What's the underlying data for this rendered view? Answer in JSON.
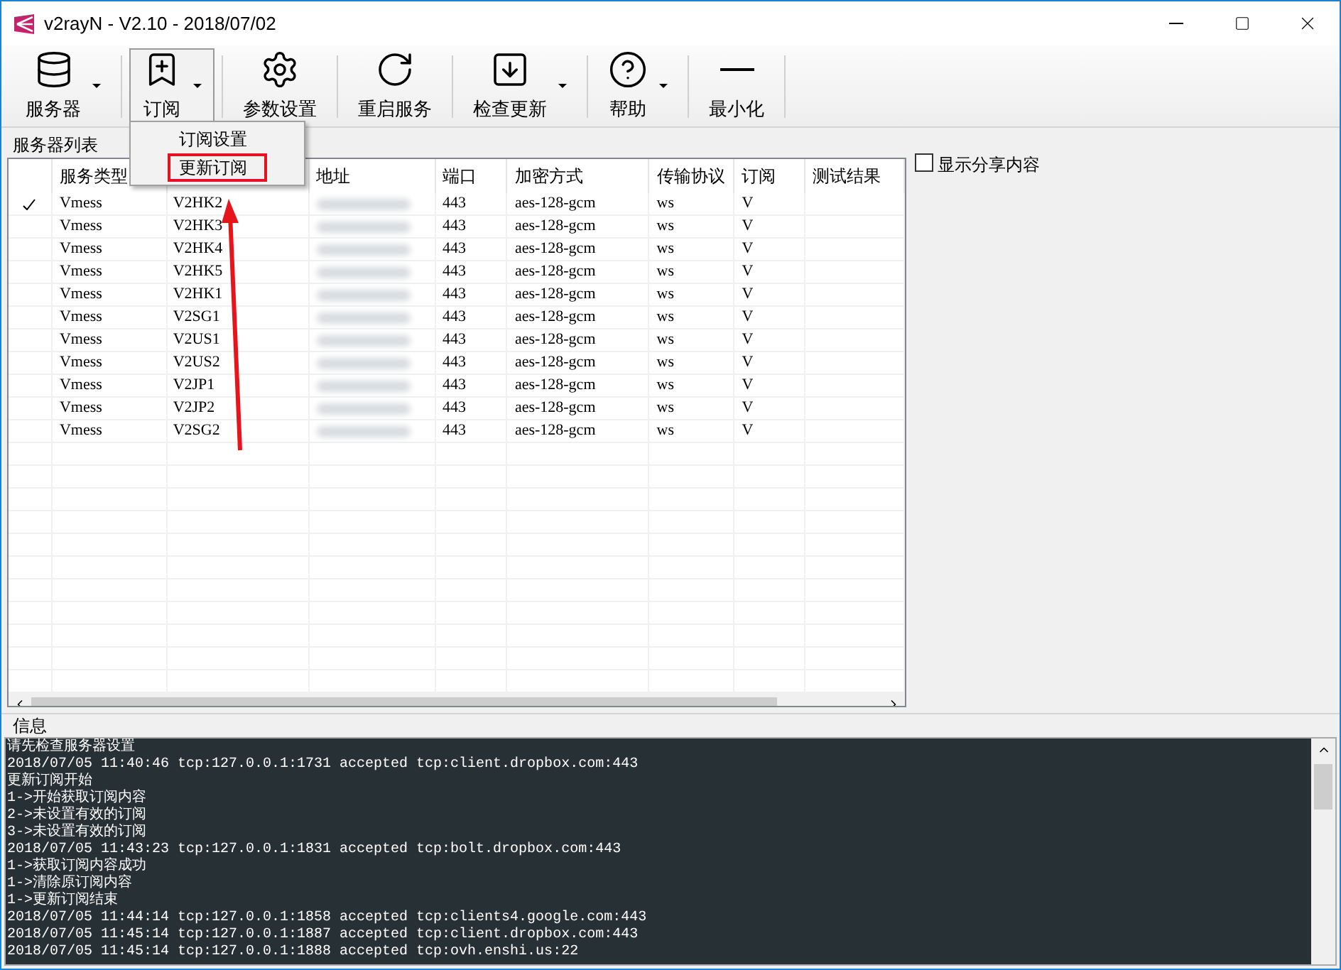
{
  "window": {
    "title": "v2rayN - V2.10 - 2018/07/02"
  },
  "toolbar": [
    {
      "label": "服务器",
      "kind": "database",
      "dropdown": true,
      "pressed": false
    },
    {
      "label": "订阅",
      "kind": "bookmark",
      "dropdown": true,
      "pressed": true
    },
    {
      "label": "参数设置",
      "kind": "gear",
      "dropdown": false,
      "pressed": false
    },
    {
      "label": "重启服务",
      "kind": "restart",
      "dropdown": false,
      "pressed": false
    },
    {
      "label": "检查更新",
      "kind": "download",
      "dropdown": true,
      "pressed": false
    },
    {
      "label": "帮助",
      "kind": "help",
      "dropdown": true,
      "pressed": false
    },
    {
      "label": "最小化",
      "kind": "minimize",
      "dropdown": false,
      "pressed": false
    }
  ],
  "menu": [
    {
      "label": "订阅设置",
      "highlighted": false
    },
    {
      "label": "更新订阅",
      "highlighted": true
    }
  ],
  "server_list": {
    "title": "服务器列表",
    "columns": [
      "服务类型",
      null,
      "地址",
      "端口",
      "加密方式",
      "传输协议",
      "订阅",
      "测试结果"
    ],
    "rows": [
      {
        "active": true,
        "type": "Vmess",
        "name": "V2HK2",
        "port": "443",
        "encryption": "aes-128-gcm",
        "transport": "ws",
        "subscription": "V"
      },
      {
        "active": false,
        "type": "Vmess",
        "name": "V2HK3",
        "port": "443",
        "encryption": "aes-128-gcm",
        "transport": "ws",
        "subscription": "V"
      },
      {
        "active": false,
        "type": "Vmess",
        "name": "V2HK4",
        "port": "443",
        "encryption": "aes-128-gcm",
        "transport": "ws",
        "subscription": "V"
      },
      {
        "active": false,
        "type": "Vmess",
        "name": "V2HK5",
        "port": "443",
        "encryption": "aes-128-gcm",
        "transport": "ws",
        "subscription": "V"
      },
      {
        "active": false,
        "type": "Vmess",
        "name": "V2HK1",
        "port": "443",
        "encryption": "aes-128-gcm",
        "transport": "ws",
        "subscription": "V"
      },
      {
        "active": false,
        "type": "Vmess",
        "name": "V2SG1",
        "port": "443",
        "encryption": "aes-128-gcm",
        "transport": "ws",
        "subscription": "V"
      },
      {
        "active": false,
        "type": "Vmess",
        "name": "V2US1",
        "port": "443",
        "encryption": "aes-128-gcm",
        "transport": "ws",
        "subscription": "V"
      },
      {
        "active": false,
        "type": "Vmess",
        "name": "V2US2",
        "port": "443",
        "encryption": "aes-128-gcm",
        "transport": "ws",
        "subscription": "V"
      },
      {
        "active": false,
        "type": "Vmess",
        "name": "V2JP1",
        "port": "443",
        "encryption": "aes-128-gcm",
        "transport": "ws",
        "subscription": "V"
      },
      {
        "active": false,
        "type": "Vmess",
        "name": "V2JP2",
        "port": "443",
        "encryption": "aes-128-gcm",
        "transport": "ws",
        "subscription": "V"
      },
      {
        "active": false,
        "type": "Vmess",
        "name": "V2SG2",
        "port": "443",
        "encryption": "aes-128-gcm",
        "transport": "ws",
        "subscription": "V"
      }
    ]
  },
  "show_share": {
    "label": "显示分享内容",
    "checked": false
  },
  "info": {
    "title": "信息",
    "lines": [
      "请先检查服务器设置",
      "2018/07/05 11:40:46 tcp:127.0.0.1:1731 accepted tcp:client.dropbox.com:443",
      "更新订阅开始",
      "1->开始获取订阅内容",
      "2->未设置有效的订阅",
      "3->未设置有效的订阅",
      "2018/07/05 11:43:23 tcp:127.0.0.1:1831 accepted tcp:bolt.dropbox.com:443",
      "1->获取订阅内容成功",
      "1->清除原订阅内容",
      "1->更新订阅结束",
      "2018/07/05 11:44:14 tcp:127.0.0.1:1858 accepted tcp:clients4.google.com:443",
      "2018/07/05 11:45:14 tcp:127.0.0.1:1887 accepted tcp:client.dropbox.com:443",
      "2018/07/05 11:45:14 tcp:127.0.0.1:1888 accepted tcp:ovh.enshi.us:22"
    ]
  }
}
